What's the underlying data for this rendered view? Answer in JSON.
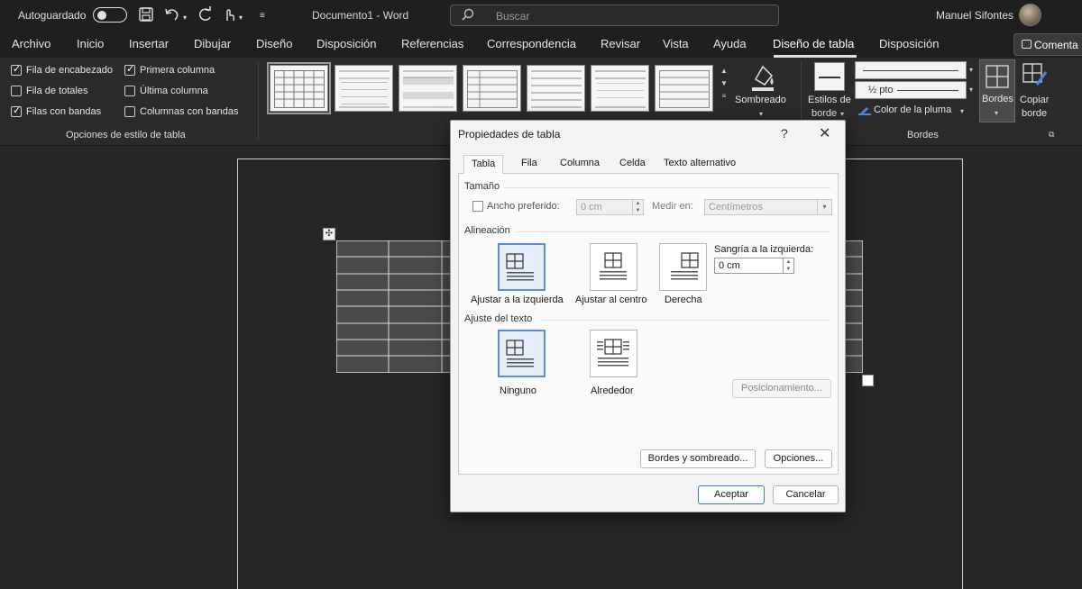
{
  "titlebar": {
    "autosave_label": "Autoguardado",
    "document_title": "Documento1 - Word",
    "search_placeholder": "Buscar",
    "user_name": "Manuel Sifontes"
  },
  "tabs": [
    {
      "label": "Archivo"
    },
    {
      "label": "Inicio"
    },
    {
      "label": "Insertar"
    },
    {
      "label": "Dibujar"
    },
    {
      "label": "Diseño"
    },
    {
      "label": "Disposición"
    },
    {
      "label": "Referencias"
    },
    {
      "label": "Correspondencia"
    },
    {
      "label": "Revisar"
    },
    {
      "label": "Vista"
    },
    {
      "label": "Ayuda"
    },
    {
      "label": "Diseño de tabla"
    },
    {
      "label": "Disposición"
    }
  ],
  "active_tab": "Diseño de tabla",
  "comment_button": "Comenta",
  "ribbon": {
    "style_options": {
      "items": [
        {
          "label": "Fila de encabezado",
          "checked": true
        },
        {
          "label": "Fila de totales",
          "checked": false
        },
        {
          "label": "Filas con bandas",
          "checked": true
        },
        {
          "label": "Primera columna",
          "checked": true
        },
        {
          "label": "Última columna",
          "checked": false
        },
        {
          "label": "Columnas con bandas",
          "checked": false
        }
      ],
      "group_label": "Opciones de estilo de tabla"
    },
    "shading_label": "Sombreado",
    "border_styles_label_1": "Estilos de",
    "border_styles_label_2": "borde",
    "pen_weight": "½ pto",
    "pen_color_label": "Color de la pluma",
    "borders_label": "Bordes",
    "copy_border_label_1": "Copiar",
    "copy_border_label_2": "borde",
    "borders_group_label": "Bordes"
  },
  "dialog": {
    "title": "Propiedades de tabla",
    "help": "?",
    "close": "✕",
    "tabs": [
      {
        "label": "Tabla"
      },
      {
        "label": "Fila"
      },
      {
        "label": "Columna"
      },
      {
        "label": "Celda"
      },
      {
        "label": "Texto alternativo"
      }
    ],
    "size": {
      "section": "Tamaño",
      "preferred_width_label": "Ancho preferido:",
      "preferred_width_value": "0 cm",
      "measure_in_label": "Medir en:",
      "measure_in_value": "Centímetros"
    },
    "alignment": {
      "section": "Alineación",
      "options": [
        {
          "label": "Ajustar a la izquierda"
        },
        {
          "label": "Ajustar al centro"
        },
        {
          "label": "Derecha"
        }
      ],
      "indent_label": "Sangría a la izquierda:",
      "indent_value": "0 cm"
    },
    "text_wrap": {
      "section": "Ajuste del texto",
      "options": [
        {
          "label": "Ninguno"
        },
        {
          "label": "Alrededor"
        }
      ],
      "positioning_button": "Posicionamiento..."
    },
    "borders_shading_button": "Bordes y sombreado...",
    "options_button": "Opciones...",
    "ok_button": "Aceptar",
    "cancel_button": "Cancelar"
  },
  "colors": {
    "chrome_dark": "#1f1f1f",
    "ribbon": "#2b2b2b",
    "dialog_bg": "#f3f3f3",
    "accent_blue": "#3b78c6"
  }
}
